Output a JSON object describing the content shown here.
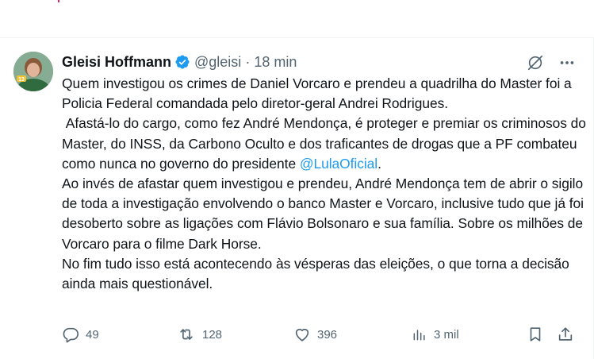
{
  "tweet": {
    "author_name": "Gleisi Hoffmann",
    "handle": "@gleisi",
    "separator": "·",
    "time": "18 min",
    "text_part1": "Quem investigou os crimes de Daniel Vorcaro e prendeu a quadrilha do Master foi a Policia Federal comandada pelo diretor-geral Andrei Rodrigues.\n Afastá-lo do cargo, como fez André Mendonça, é proteger e premiar os criminosos do Master, do INSS, da Carbono Oculto e dos traficantes de drogas que a PF combateu como nunca no governo do presidente ",
    "mention": "@LulaOficial",
    "text_part2": ".\nAo invés de afastar quem investigou e prendeu, André Mendonça tem de abrir o sigilo de toda a investigação envolvendo o banco Master e Vorcaro, inclusive tudo que já foi desoberto sobre as ligações com Flávio Bolsonaro e sua família. Sobre os milhões de Vorcaro para o filme Dark Horse.\nNo fim tudo isso está acontecendo às vésperas das eleições, o que torna a decisão ainda mais questionável.",
    "avatar_badge": "13"
  },
  "actions": {
    "replies": "49",
    "reposts": "128",
    "likes": "396",
    "views": "3 mil"
  },
  "icons": [
    "verified-badge-icon",
    "grok-icon",
    "more-icon",
    "reply-icon",
    "repost-icon",
    "like-icon",
    "views-icon",
    "bookmark-icon",
    "share-icon"
  ],
  "colors": {
    "accent": "#1d9bf0",
    "muted": "#536471",
    "text": "#0f1419"
  }
}
